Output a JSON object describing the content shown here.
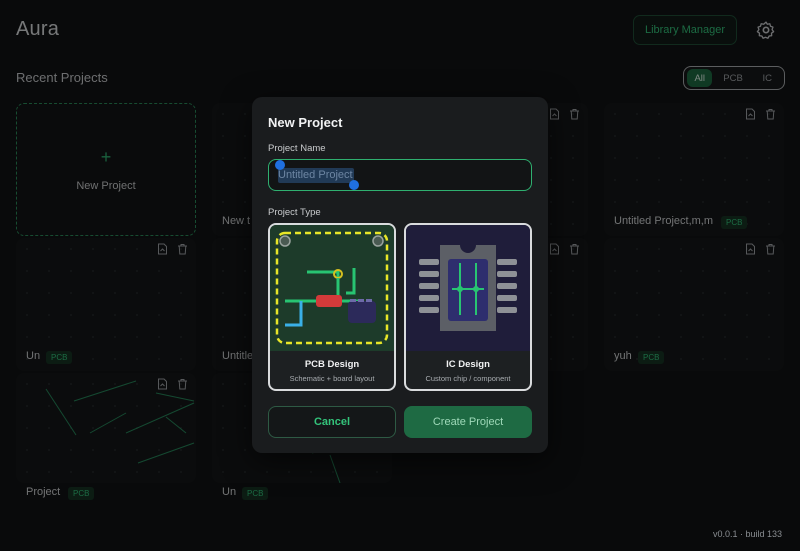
{
  "app": {
    "title": "Aura"
  },
  "header": {
    "library_button": "Library Manager",
    "settings_icon": "gear-icon"
  },
  "section": {
    "title": "Recent Projects"
  },
  "filters": {
    "options": [
      "All",
      "PCB",
      "IC"
    ],
    "selected": "All"
  },
  "new_project_card": {
    "label": "New Project",
    "icon": "plus-icon"
  },
  "projects": [
    {
      "name": "New t",
      "date": ""
    },
    {
      "name": "Untitled Project,m,m",
      "badge": "PCB",
      "date": ""
    },
    {
      "name": "Un",
      "badge": "PCB",
      "date": ""
    },
    {
      "name": "Untitle",
      "date": ""
    },
    {
      "name": "yuh",
      "badge": "PCB",
      "date": ""
    },
    {
      "name": "Project",
      "badge": "PCB"
    },
    {
      "name": "Un",
      "badge": "PCB"
    }
  ],
  "modal": {
    "title": "New Project",
    "name_label": "Project Name",
    "name_value": "Untitled Project",
    "type_label": "Project Type",
    "types": [
      {
        "title": "PCB Design",
        "subtitle": "Schematic + board layout"
      },
      {
        "title": "IC Design",
        "subtitle": "Custom chip / component"
      }
    ],
    "cancel_label": "Cancel",
    "create_label": "Create Project"
  },
  "footer": {
    "version": "v0.0.1 · build 133"
  },
  "colors": {
    "accent": "#2fb070",
    "accent_dark": "#1e6a43",
    "background": "#111314",
    "selection": "#1f6fe0"
  }
}
